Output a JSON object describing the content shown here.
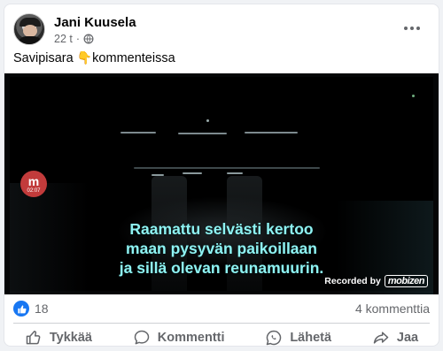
{
  "post": {
    "author": "Jani Kuusela",
    "time": "22 t",
    "separator": "·",
    "text_prefix": "Savipisara ",
    "text_emoji": "👇",
    "text_suffix": "kommenteissa"
  },
  "video": {
    "badge_letter": "m",
    "badge_time": "02:07",
    "caption_lines": [
      "Raamattu selvästi kertoo",
      "maan pysyvän paikoillaan",
      "ja sillä olevan reunamuurin."
    ],
    "recorded_label": "Recorded by",
    "recorder_logo": "mobizen"
  },
  "stats": {
    "reactions_count": "18",
    "comments": "4 kommenttia"
  },
  "actions": {
    "like": "Tykkää",
    "comment": "Kommentti",
    "send": "Lähetä",
    "share": "Jaa"
  },
  "colors": {
    "accent": "#1877f2",
    "caption": "#8ff3f3",
    "badge": "#c23b3b"
  }
}
